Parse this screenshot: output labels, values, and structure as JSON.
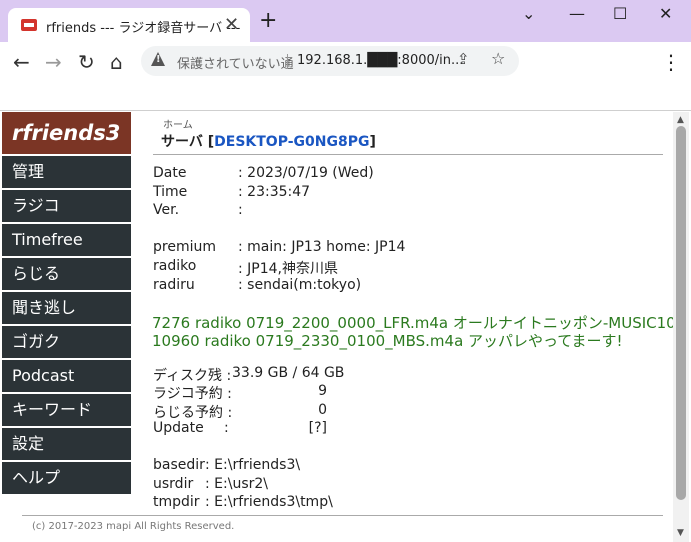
{
  "browser": {
    "tab_title": "rfriends --- ラジオ録音サーバ ---",
    "tab_close": "✕",
    "new_tab": "+",
    "win_minimize": "⌄",
    "win_min": "—",
    "win_max": "☐",
    "win_close": "✕",
    "back": "←",
    "forward": "→",
    "reload": "↻",
    "home": "⌂",
    "secure_label": "保護されていない通",
    "url": "192.168.1.███:8000/in...",
    "menu": "⋮"
  },
  "sidebar": {
    "logo": "rfriends3",
    "items": [
      {
        "label": "管理"
      },
      {
        "label": "ラジコ"
      },
      {
        "label": "Timefree"
      },
      {
        "label": "らじる"
      },
      {
        "label": "聞き逃し"
      },
      {
        "label": "ゴガク"
      },
      {
        "label": "Podcast"
      },
      {
        "label": "キーワード"
      },
      {
        "label": "設定"
      },
      {
        "label": "ヘルプ"
      }
    ]
  },
  "main": {
    "breadcrumb": "ホーム",
    "server_prefix": "サーバ [",
    "server_host": "DESKTOP-G0NG8PG",
    "server_suffix": "]",
    "info": {
      "date_label": "Date",
      "date_value": ": 2023/07/19 (Wed)",
      "time_label": "Time",
      "time_value": ": 23:35:47",
      "ver_label": "Ver.",
      "ver_value": ":",
      "premium_label": "premium",
      "premium_value": ": main: JP13 home: JP14",
      "radiko_label": "radiko",
      "radiko_value": ": JP14,神奈川県",
      "radiru_label": "radiru",
      "radiru_value": ": sendai(m:tokyo)"
    },
    "recordings": [
      "7276 radiko 0719_2200_0000_LFR.m4a オールナイトニッポン-MUSIC10",
      "10960 radiko 0719_2330_0100_MBS.m4a アッパレやってまーす!"
    ],
    "status": {
      "disk_label": "ディスク残 :",
      "disk_value": "33.9 GB / 64 GB",
      "radiko_res_label": "ラジコ予約 :",
      "radiko_res_value": "9",
      "radiru_res_label": "らじる予約 :",
      "radiru_res_value": "0",
      "update_label": "Update",
      "update_colon": ":",
      "update_value": "[?]"
    },
    "dirs": {
      "basedir_label": "basedir",
      "basedir_value": ": E:\\rfriends3\\",
      "usrdir_label": "usrdir",
      "usrdir_value": ": E:\\usr2\\",
      "tmpdir_label": "tmpdir",
      "tmpdir_value": ": E:\\rfriends3\\tmp\\"
    },
    "footer": "(c) 2017-2023 mapi All Rights Reserved."
  }
}
